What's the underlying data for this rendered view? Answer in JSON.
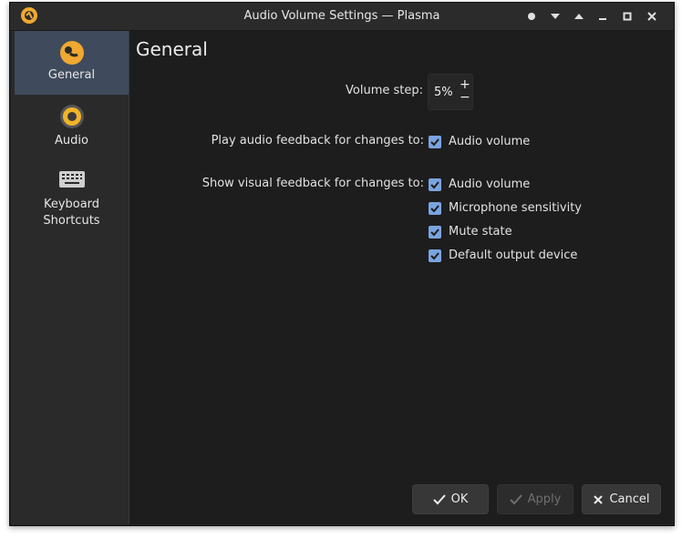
{
  "window": {
    "title": "Audio Volume Settings — Plasma",
    "app_icon": "audio-volume-icon",
    "controls": [
      "pin-icon",
      "chevron-down-icon",
      "chevron-up-icon",
      "minimize-icon",
      "maximize-icon",
      "close-icon"
    ]
  },
  "sidebar": {
    "items": [
      {
        "label": "General",
        "icon": "general-volume-icon",
        "active": true
      },
      {
        "label": "Audio",
        "icon": "speaker-icon",
        "active": false
      },
      {
        "label": "Keyboard Shortcuts",
        "label_line1": "Keyboard",
        "label_line2": "Shortcuts",
        "icon": "keyboard-icon",
        "active": false
      }
    ]
  },
  "main": {
    "title": "General",
    "volume_step": {
      "label": "Volume step:",
      "value": "5%"
    },
    "audio_feedback": {
      "label": "Play audio feedback for changes to:",
      "options": [
        {
          "label": "Audio volume",
          "checked": true
        }
      ]
    },
    "visual_feedback": {
      "label": "Show visual feedback for changes to:",
      "options": [
        {
          "label": "Audio volume",
          "checked": true
        },
        {
          "label": "Microphone sensitivity",
          "checked": true
        },
        {
          "label": "Mute state",
          "checked": true
        },
        {
          "label": "Default output device",
          "checked": true
        }
      ]
    }
  },
  "buttons": {
    "ok": "OK",
    "apply": "Apply",
    "cancel": "Cancel"
  },
  "colors": {
    "accent": "#7aa4e0",
    "icon_orange": "#f0a830",
    "sidebar_active": "#3f4b5c"
  }
}
